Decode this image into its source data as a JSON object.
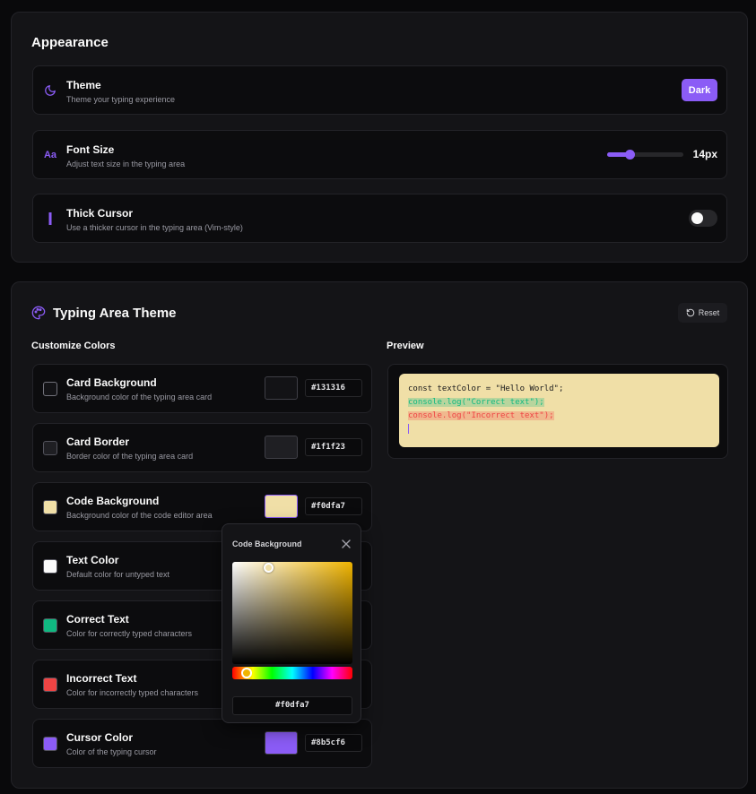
{
  "appearance": {
    "title": "Appearance",
    "theme": {
      "title": "Theme",
      "desc": "Theme your typing experience",
      "value": "Dark",
      "icon": "moon-icon"
    },
    "font_size": {
      "title": "Font Size",
      "desc": "Adjust text size in the typing area",
      "value_label": "14px",
      "slider_fraction": 0.29,
      "icon": "Aa"
    },
    "thick_cursor": {
      "title": "Thick Cursor",
      "desc": "Use a thicker cursor in the typing area (Vim-style)",
      "enabled": false,
      "icon": "cursor-bar-icon"
    }
  },
  "typing_theme": {
    "title": "Typing Area Theme",
    "reset_label": "Reset",
    "customize_label": "Customize Colors",
    "preview_label": "Preview",
    "colors": [
      {
        "title": "Card Background",
        "desc": "Background color of the typing area card",
        "hex": "#131316",
        "show_big_swatch": true
      },
      {
        "title": "Card Border",
        "desc": "Border color of the typing area card",
        "hex": "#1f1f23",
        "show_big_swatch": true
      },
      {
        "title": "Code Background",
        "desc": "Background color of the code editor area",
        "hex": "#f0dfa7",
        "show_big_swatch": true
      },
      {
        "title": "Text Color",
        "desc": "Default color for untyped text",
        "hex": "#fafafa",
        "show_big_swatch": false
      },
      {
        "title": "Correct Text",
        "desc": "Color for correctly typed characters",
        "hex": "#10b981",
        "show_big_swatch": false
      },
      {
        "title": "Incorrect Text",
        "desc": "Color for incorrectly typed characters",
        "hex": "#ef4444",
        "show_big_swatch": false
      },
      {
        "title": "Cursor Color",
        "desc": "Color of the typing cursor",
        "hex": "#8b5cf6",
        "show_big_swatch": true
      }
    ],
    "preview": {
      "line1": "const textColor = \"Hello World\";",
      "line2": "console.log(\"Correct text\");",
      "line3": "console.log(\"Incorrect text\");",
      "code_bg": "#f0dfa7",
      "base_text": "#18181b",
      "correct_text": "#10b981",
      "incorrect_text": "#ef4444",
      "cursor": "#8b5cf6"
    },
    "picker": {
      "title": "Code Background",
      "value": "#f0dfa7",
      "saturation": 0.3,
      "brightness": 0.95,
      "hue_fraction": 0.12
    }
  },
  "colors": {
    "accent": "#8b5cf6"
  }
}
